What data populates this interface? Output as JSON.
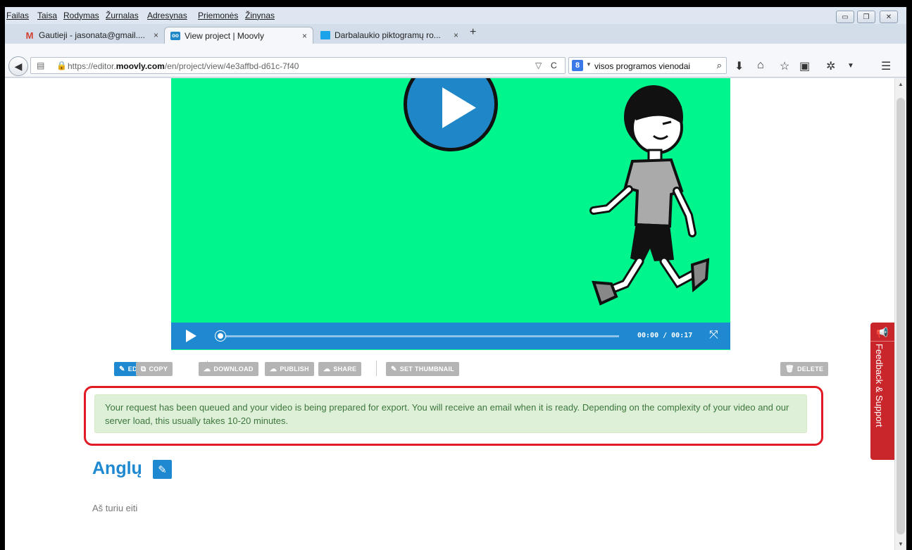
{
  "menu": [
    "Failas",
    "Taisa",
    "Rodymas",
    "Žurnalas",
    "Adresynas",
    "Priemonės",
    "Žinynas"
  ],
  "tabs": [
    {
      "label": "Gautieji - jasonata@gmail....",
      "close": "×",
      "icon": "gmail-icon"
    },
    {
      "label": "View project | Moovly",
      "close": "×",
      "icon": "moovly-icon"
    },
    {
      "label": "Darbalaukio piktogramų ro...",
      "close": "×",
      "icon": "windows-icon"
    }
  ],
  "new_tab": "+",
  "url": {
    "prefix": "https://editor.",
    "domain": "moovly.com",
    "path": "/en/project/view/4e3affbd-d61c-7f40"
  },
  "search": {
    "engine": "8",
    "value": "visos programos vienodai"
  },
  "player": {
    "time": "00:00 / 00:17",
    "progress": 0.0
  },
  "actions": {
    "edit": "EDIT",
    "copy": "COPY",
    "download": "DOWNLOAD",
    "publish": "PUBLISH",
    "share": "SHARE",
    "set_thumbnail": "SET THUMBNAIL",
    "delete": "DELETE"
  },
  "alert": "Your request has been queued and your video is being prepared for export. You will receive an email when it is ready. Depending on the complexity of your video and our server load, this usually takes 10-20 minutes.",
  "project": {
    "title": "Anglų",
    "description": "Aš turiu eiti"
  },
  "feedback": "Feedback & Support",
  "colors": {
    "accent": "#1e88d0",
    "video_bg": "#00f58d",
    "alert_bg": "#dff0d8",
    "alert_text": "#3c763d",
    "feedback": "#c9262c",
    "highlight": "#e01b24"
  }
}
